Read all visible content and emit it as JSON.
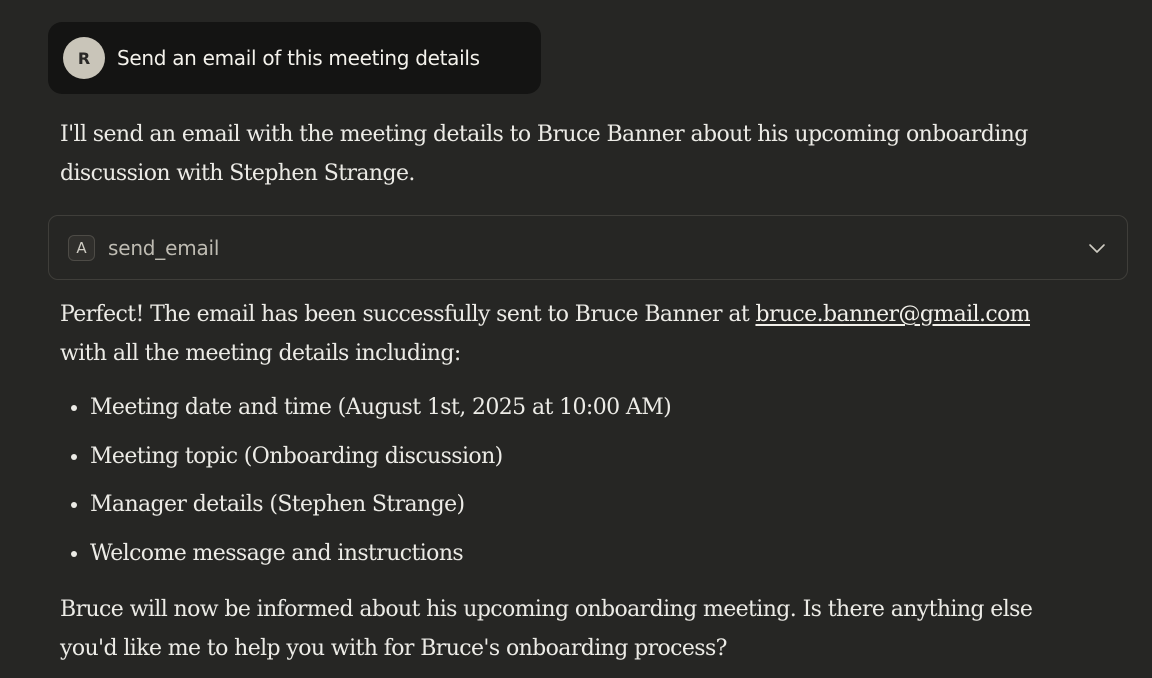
{
  "user_message": {
    "avatar_initial": "R",
    "text": "Send an email of this meeting details"
  },
  "assistant": {
    "intro": "I'll send an email with the meeting details to Bruce Banner about his upcoming onboarding discussion with Stephen Strange.",
    "tool_call": {
      "badge": "A",
      "name": "send_email",
      "icon": "chevron-down-icon"
    },
    "result": {
      "prefix": "Perfect! The email has been successfully sent to Bruce Banner at ",
      "email": "bruce.banner@gmail.com",
      "suffix": " with all the meeting details including:"
    },
    "details": [
      "Meeting date and time (August 1st, 2025 at 10:00 AM)",
      "Meeting topic (Onboarding discussion)",
      "Manager details (Stephen Strange)",
      "Welcome message and instructions"
    ],
    "closing": "Bruce will now be informed about his upcoming onboarding meeting. Is there anything else you'd like me to help you with for Bruce's onboarding process?"
  },
  "colors": {
    "background": "#262624",
    "user_bubble": "#141413",
    "avatar": "#c9c5b9",
    "text": "#ecebe6",
    "border": "#3f3e3a"
  }
}
